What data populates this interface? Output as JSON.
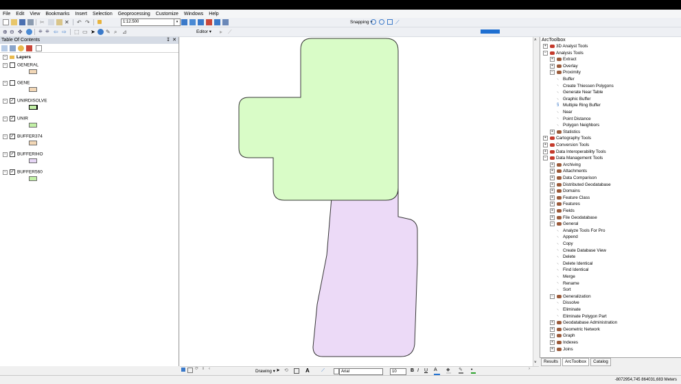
{
  "menu": [
    "File",
    "Edit",
    "View",
    "Bookmarks",
    "Insert",
    "Selection",
    "Geoprocessing",
    "Customize",
    "Windows",
    "Help"
  ],
  "toolbar": {
    "scale": "1:12.500",
    "snapping": "Snapping ▾",
    "editor": "Editor ▾",
    "drawing": "Drawing ▾",
    "font": "Arial",
    "font_size": "10",
    "bold": "B",
    "italic": "I",
    "underline": "U",
    "text_tool": "A"
  },
  "toc": {
    "title": "Table Of Contents",
    "close": "✕",
    "pin": "↧",
    "root": "Layers",
    "layers": [
      {
        "name": "GENERAL",
        "checked": false,
        "color": "#f2d7b6"
      },
      {
        "name": "GENE",
        "checked": false,
        "color": "#f2d7b6"
      },
      {
        "name": "UNIRDISOLVE",
        "checked": true,
        "color": "#c2f0a6"
      },
      {
        "name": "UNIR",
        "checked": true,
        "color": "#c2f0a6"
      },
      {
        "name": "BUFFER374",
        "checked": true,
        "color": "#f2d7b6"
      },
      {
        "name": "BUFFERIHO",
        "checked": true,
        "color": "#e6d6f5"
      },
      {
        "name": "BUFFER560",
        "checked": true,
        "color": "#c2f0a6"
      }
    ]
  },
  "map": {
    "green_fill": "#d9fcc7",
    "purple_fill": "#ecdaf7"
  },
  "arctoolbox": {
    "title": "ArcToolbox",
    "items": [
      {
        "label": "3D Analyst Tools",
        "level": 0,
        "type": "box",
        "exp": "+"
      },
      {
        "label": "Analysis Tools",
        "level": 0,
        "type": "box",
        "exp": "-"
      },
      {
        "label": "Extract",
        "level": 1,
        "type": "set",
        "exp": "+"
      },
      {
        "label": "Overlay",
        "level": 1,
        "type": "set",
        "exp": "+"
      },
      {
        "label": "Proximity",
        "level": 1,
        "type": "set",
        "exp": "-"
      },
      {
        "label": "Buffer",
        "level": 2,
        "type": "tool"
      },
      {
        "label": "Create Thiessen Polygons",
        "level": 2,
        "type": "tool"
      },
      {
        "label": "Generate Near Table",
        "level": 2,
        "type": "tool"
      },
      {
        "label": "Graphic Buffer",
        "level": 2,
        "type": "tool"
      },
      {
        "label": "Multiple Ring Buffer",
        "level": 2,
        "type": "script"
      },
      {
        "label": "Near",
        "level": 2,
        "type": "tool"
      },
      {
        "label": "Point Distance",
        "level": 2,
        "type": "tool"
      },
      {
        "label": "Polygon Neighbors",
        "level": 2,
        "type": "tool"
      },
      {
        "label": "Statistics",
        "level": 1,
        "type": "set",
        "exp": "+"
      },
      {
        "label": "Cartography Tools",
        "level": 0,
        "type": "box",
        "exp": "+"
      },
      {
        "label": "Conversion Tools",
        "level": 0,
        "type": "box",
        "exp": "+"
      },
      {
        "label": "Data Interoperability Tools",
        "level": 0,
        "type": "box",
        "exp": "+"
      },
      {
        "label": "Data Management Tools",
        "level": 0,
        "type": "box",
        "exp": "-"
      },
      {
        "label": "Archiving",
        "level": 1,
        "type": "set",
        "exp": "+"
      },
      {
        "label": "Attachments",
        "level": 1,
        "type": "set",
        "exp": "+"
      },
      {
        "label": "Data Comparison",
        "level": 1,
        "type": "set",
        "exp": "+"
      },
      {
        "label": "Distributed Geodatabase",
        "level": 1,
        "type": "set",
        "exp": "+"
      },
      {
        "label": "Domains",
        "level": 1,
        "type": "set",
        "exp": "+"
      },
      {
        "label": "Feature Class",
        "level": 1,
        "type": "set",
        "exp": "+"
      },
      {
        "label": "Features",
        "level": 1,
        "type": "set",
        "exp": "+"
      },
      {
        "label": "Fields",
        "level": 1,
        "type": "set",
        "exp": "+"
      },
      {
        "label": "File Geodatabase",
        "level": 1,
        "type": "set",
        "exp": "+"
      },
      {
        "label": "General",
        "level": 1,
        "type": "set",
        "exp": "-"
      },
      {
        "label": "Analyze Tools For Pro",
        "level": 2,
        "type": "tool"
      },
      {
        "label": "Append",
        "level": 2,
        "type": "tool"
      },
      {
        "label": "Copy",
        "level": 2,
        "type": "tool"
      },
      {
        "label": "Create Database View",
        "level": 2,
        "type": "tool"
      },
      {
        "label": "Delete",
        "level": 2,
        "type": "tool"
      },
      {
        "label": "Delete Identical",
        "level": 2,
        "type": "tool"
      },
      {
        "label": "Find Identical",
        "level": 2,
        "type": "tool"
      },
      {
        "label": "Merge",
        "level": 2,
        "type": "tool"
      },
      {
        "label": "Rename",
        "level": 2,
        "type": "tool"
      },
      {
        "label": "Sort",
        "level": 2,
        "type": "tool"
      },
      {
        "label": "Generalization",
        "level": 1,
        "type": "set",
        "exp": "-"
      },
      {
        "label": "Dissolve",
        "level": 2,
        "type": "tool"
      },
      {
        "label": "Eliminate",
        "level": 2,
        "type": "tool"
      },
      {
        "label": "Eliminate Polygon Part",
        "level": 2,
        "type": "tool"
      },
      {
        "label": "Geodatabase Administration",
        "level": 1,
        "type": "set",
        "exp": "+"
      },
      {
        "label": "Geometric Network",
        "level": 1,
        "type": "set",
        "exp": "+"
      },
      {
        "label": "Graph",
        "level": 1,
        "type": "set",
        "exp": "+"
      },
      {
        "label": "Indexes",
        "level": 1,
        "type": "set",
        "exp": "+"
      },
      {
        "label": "Joins",
        "level": 1,
        "type": "set",
        "exp": "+"
      }
    ],
    "tabs": [
      "Results",
      "ArcToolbox",
      "Catalog"
    ]
  },
  "status": {
    "coords": "-8072954,745  864031,683 Meters"
  }
}
